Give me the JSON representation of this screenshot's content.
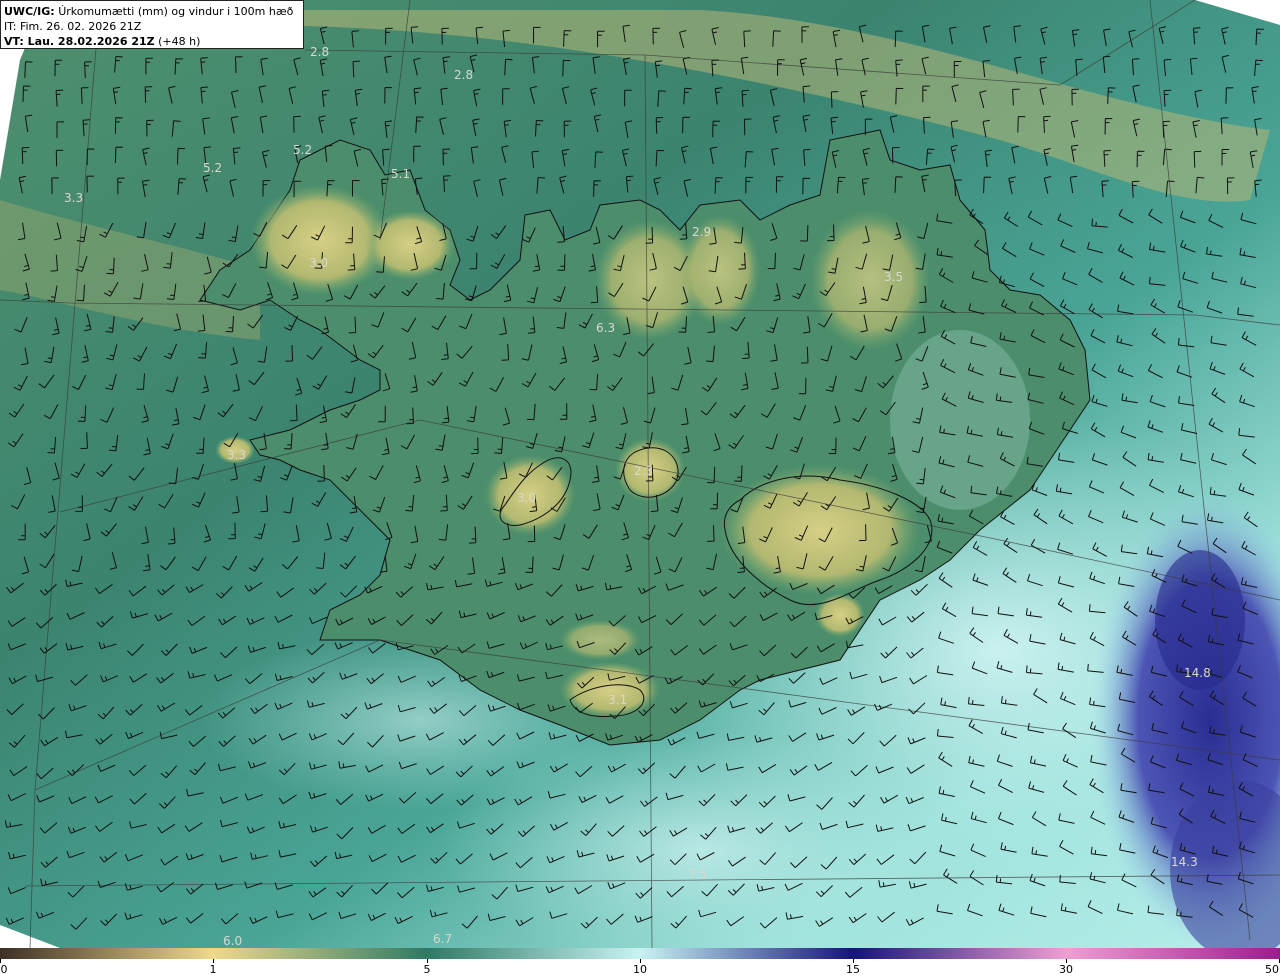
{
  "header": {
    "product": "UWC/IG:",
    "description": "Úrkomumætti (mm) og vindur i 100m hæð",
    "init_time": "IT: Fim. 26. 02. 2026 21Z",
    "valid_label": "VT: Lau. 28.02.2026 21Z",
    "lead_time": "(+48 h)"
  },
  "map_value_labels": [
    "2.8",
    "2.8",
    "5.2",
    "5.2",
    "5.1",
    "3.3",
    "3.0",
    "2.9",
    "3.5",
    "6.3",
    "3.3",
    "3.0",
    "2.3",
    "3.1",
    "14.8",
    "14.3",
    "7.5",
    "6.0",
    "6.7"
  ],
  "colorbar": {
    "ticks": [
      "0",
      "1",
      "5",
      "10",
      "15",
      "30",
      "50"
    ],
    "colors": {
      "0": "#3d2f26",
      "1": "#efd98c",
      "5": "#2e7a65",
      "10": "#c9f3f3",
      "15": "#14147a",
      "30": "#f09ed2",
      "50": "#9b1c8f"
    }
  },
  "colors": {
    "land_high": "#c9c77a",
    "land_mid": "#5f9c72",
    "sea_teal": "#2c7565",
    "sea_light": "#9fe0dc",
    "heavy_precip": "#3b3d9e",
    "grid_line": "#333333"
  }
}
